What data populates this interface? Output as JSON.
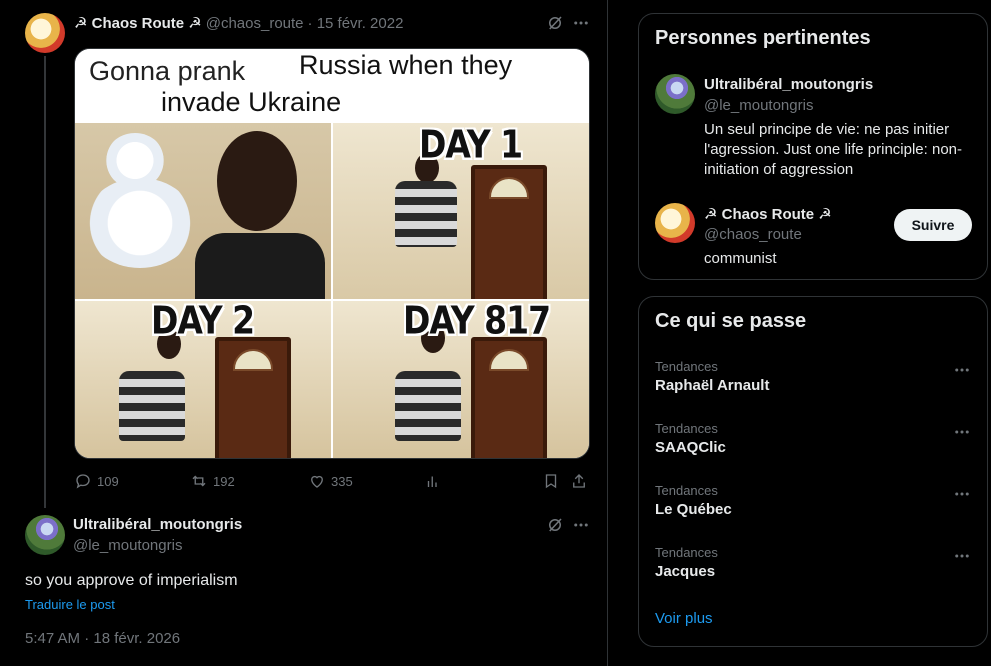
{
  "tweet": {
    "author_name": "☭ Chaos Route ☭",
    "author_handle": "@chaos_route",
    "date": "· 15 févr. 2022",
    "meme": {
      "caption_left": "Gonna prank",
      "caption_right": "Russia when they",
      "caption_line2": "invade Ukraine",
      "panels": [
        "DAY 1",
        "DAY 2",
        "DAY 817"
      ]
    },
    "stats": {
      "replies": "109",
      "reposts": "192",
      "likes": "335"
    }
  },
  "reply": {
    "author_name": "Ultralibéral_moutongris",
    "author_handle": "@le_moutongris",
    "text": "so you approve of imperialism",
    "translate_label": "Traduire le post",
    "timestamp": "5:47 AM · 18 févr. 2026"
  },
  "sidebar": {
    "relevant": {
      "title": "Personnes pertinentes",
      "users": [
        {
          "name": "Ultralibéral_moutongris",
          "handle": "@le_moutongris",
          "bio": "Un seul principe de vie: ne pas initier l'agression. Just one life principle: non-initiation of aggression"
        },
        {
          "name": "☭ Chaos Route ☭",
          "handle": "@chaos_route",
          "bio": "communist",
          "follow_label": "Suivre"
        }
      ]
    },
    "trends": {
      "title": "Ce qui se passe",
      "items": [
        {
          "category": "Tendances",
          "name": "Raphaël Arnault"
        },
        {
          "category": "Tendances",
          "name": "SAAQClic"
        },
        {
          "category": "Tendances",
          "name": "Le Québec"
        },
        {
          "category": "Tendances",
          "name": "Jacques"
        }
      ],
      "more_label": "Voir plus"
    }
  }
}
